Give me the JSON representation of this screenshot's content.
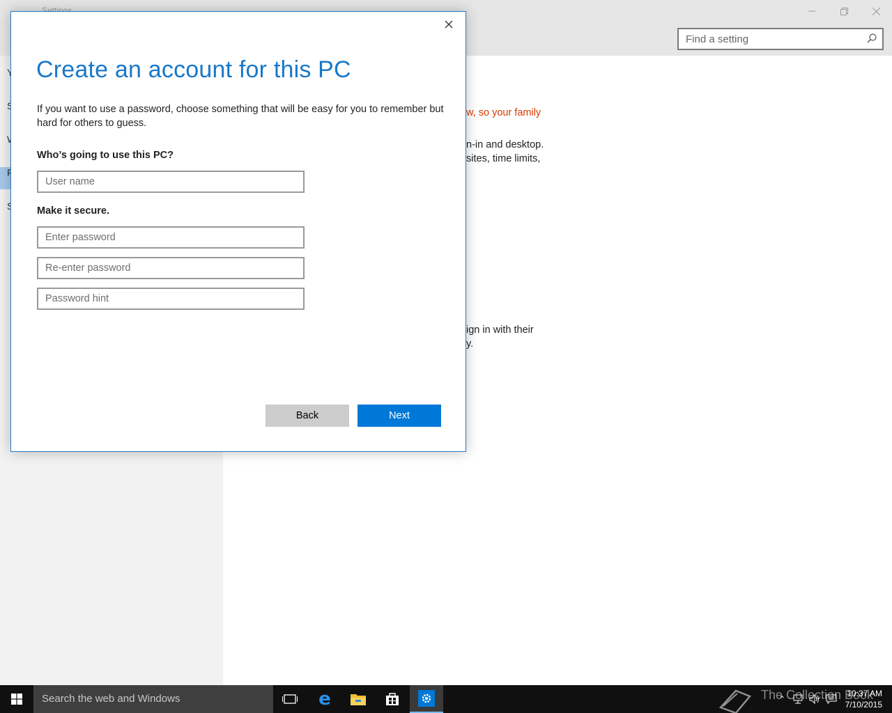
{
  "settings": {
    "title": "Settings",
    "search_placeholder": "Find a setting",
    "nav_items": [
      "Y",
      "S",
      "W",
      "F",
      "S"
    ],
    "bg_text": [
      "w, so your family",
      "n-in and desktop.",
      "sites, time limits,",
      "ign in with their",
      "y."
    ]
  },
  "dialog": {
    "title": "Create an account for this PC",
    "description": "If you want to use a password, choose something that will be easy for you to remember but hard for others to guess.",
    "who_label": "Who’s going to use this PC?",
    "username_placeholder": "User name",
    "secure_label": "Make it secure.",
    "password_placeholder": "Enter password",
    "reenter_placeholder": "Re-enter password",
    "hint_placeholder": "Password hint",
    "back_label": "Back",
    "next_label": "Next"
  },
  "taskbar": {
    "search_text": "Search the web and Windows",
    "watermark": "The Collection Book",
    "time": "10:37 AM",
    "date": "7/10/2015"
  },
  "colors": {
    "accent": "#0078d7",
    "title_blue": "#1a78c8",
    "warning_orange": "#d83b01"
  }
}
